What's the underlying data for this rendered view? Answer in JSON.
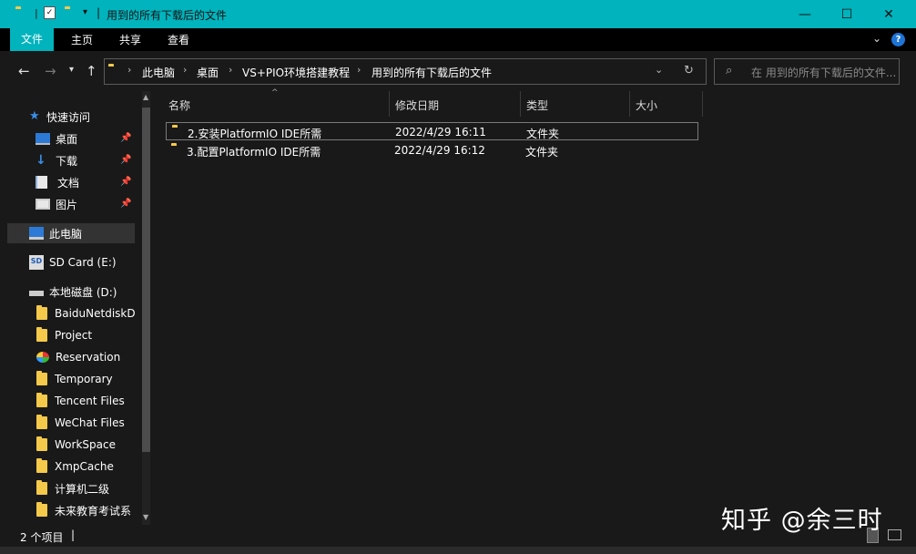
{
  "window": {
    "title": "用到的所有下载后的文件",
    "controls": {
      "minimize": "—",
      "maximize": "☐",
      "close": "✕"
    }
  },
  "ribbon": {
    "tabs": [
      "文件",
      "主页",
      "共享",
      "查看"
    ],
    "active_tab": "文件"
  },
  "address": {
    "crumbs": [
      "此电脑",
      "桌面",
      "VS+PIO环境搭建教程",
      "用到的所有下载后的文件"
    ]
  },
  "search": {
    "placeholder": "在 用到的所有下载后的文件..."
  },
  "sidebar": {
    "quick_access": "快速访问",
    "pinned": [
      "桌面",
      "下载",
      "文档",
      "图片"
    ],
    "this_pc": "此电脑",
    "sd_card": "SD Card (E:)",
    "local_disk": "本地磁盘 (D:)",
    "folders": [
      "BaiduNetdiskD",
      "Project",
      "Reservation",
      "Temporary",
      "Tencent Files",
      "WeChat Files",
      "WorkSpace",
      "XmpCache",
      "计算机二级",
      "未来教育考试系"
    ]
  },
  "columns": [
    "名称",
    "修改日期",
    "类型",
    "大小"
  ],
  "files": [
    {
      "name": "2.安装PlatformIO IDE所需",
      "date": "2022/4/29 16:11",
      "type": "文件夹",
      "size": ""
    },
    {
      "name": "3.配置PlatformIO IDE所需",
      "date": "2022/4/29 16:12",
      "type": "文件夹",
      "size": ""
    }
  ],
  "status": {
    "count": "2 个项目",
    "sep": "|"
  },
  "watermark": "知乎 @余三时",
  "colors": {
    "accent": "#00b3bd",
    "background": "#191919",
    "folder": "#f5c94a"
  }
}
